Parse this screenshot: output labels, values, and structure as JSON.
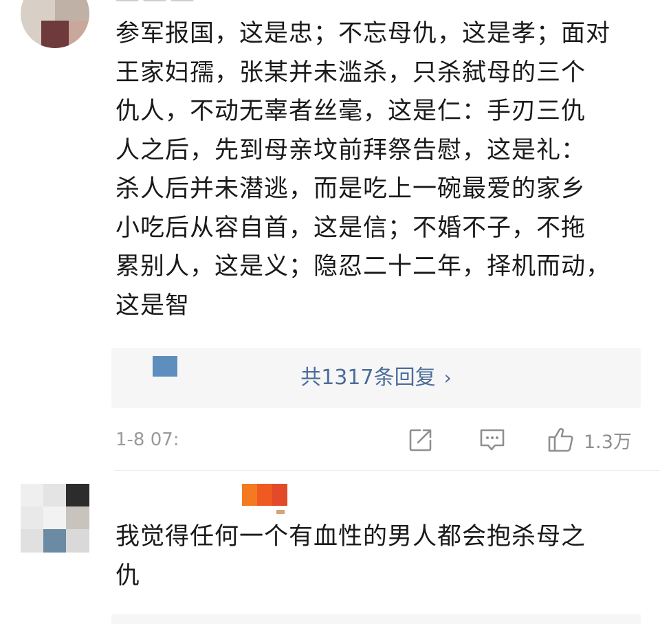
{
  "comment1": {
    "text": "参军报国，这是忠；不忘母仇，这是孝；面对\n王家妇孺，张某并未滥杀，只杀弑母的三个\n仇人，不动无辜者丝毫，这是仁：手刃三仇\n人之后，先到母亲坟前拜祭告慰，这是礼：\n杀人后并未潜逃，而是吃上一碗最爱的家乡\n小吃后从容自首，这是信；不婚不子，不拖\n累别人，这是义；隐忍二十二年，择机而动，\n这是智",
    "replies_label": "共1317条回复",
    "replies_chevron": "›",
    "time": "1-8 07:",
    "like_count": "1.3万",
    "avatar_icon": "avatar-mosaic",
    "share_icon": "share-icon",
    "comment_icon": "comment-icon",
    "like_icon": "thumbs-up-icon"
  },
  "comment2": {
    "text": "我觉得任何一个有血性的男人都会抱杀母之\n仇",
    "avatar_icon": "avatar-mosaic"
  },
  "colors": {
    "reply_link": "#4d6c9a",
    "reply_bg": "#f6f6f6",
    "meta_gray": "#9a9a9a",
    "badge_orange": "#f1601c",
    "text": "#1a1a1a"
  }
}
